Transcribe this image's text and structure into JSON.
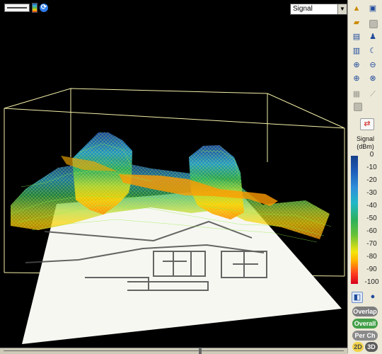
{
  "top_controls": {
    "slider": "view-slider",
    "legend": "mini-legend",
    "refresh": "refresh-icon"
  },
  "select": {
    "value": "Signal"
  },
  "toolbar": {
    "buttons": [
      "warning-icon",
      "print-icon",
      "folder-icon",
      "square-icon",
      "display-icon",
      "walk-icon",
      "save-icon",
      "moon-icon",
      "zoom-in-icon",
      "zoom-out-icon",
      "zoom-area-icon",
      "zoom-reset-icon",
      "grid-icon",
      "measure-icon",
      "gray-square-icon",
      "swap-icon"
    ]
  },
  "legend": {
    "title_line1": "Signal",
    "title_line2": "(dBm)",
    "ticks": [
      "0",
      "-10",
      "-20",
      "-30",
      "-40",
      "-50",
      "-60",
      "-70",
      "-80",
      "-90",
      "-100"
    ],
    "colors": {
      "high": "#153f8a",
      "mid": "#2bb15b",
      "low": "#d6001b"
    }
  },
  "bottom_buttons": {
    "overlap": "Overlap",
    "overall": "Overall",
    "per_ch": "Per Ch",
    "view2d": "2D",
    "view3d": "3D"
  }
}
